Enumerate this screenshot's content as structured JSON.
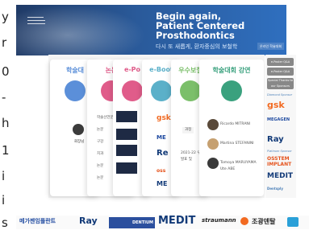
{
  "left_edge": [
    "y",
    "r",
    "0",
    "-",
    "h",
    "1",
    "i",
    "i",
    "s"
  ],
  "banner": {
    "title_line1": "Begin again,",
    "title_line2": "Patient Centered",
    "title_line3": "Prosthodontics",
    "subtitle": "다시 또 새롭게, 환자중심의 보철학",
    "corner": "온라인 학술대회"
  },
  "cards": [
    {
      "heading": "학술대",
      "color": "#5b8fd9"
    },
    {
      "heading": "논문",
      "color": "#e05c8a"
    },
    {
      "heading": "e-Po",
      "color": "#e05c8a"
    },
    {
      "heading": "e-Boot",
      "color": "#5bb0c9"
    },
    {
      "heading": "우수보철",
      "color": "#7bbf6a"
    },
    {
      "heading": "학술대회 강연",
      "color": "#3aa17e"
    }
  ],
  "card2_rows": [
    "학술선언문",
    "논문",
    "구강",
    "치과",
    "논문",
    "논문"
  ],
  "card4_brands": [
    "gsk",
    "ME",
    "Re",
    "oss",
    "ME"
  ],
  "speakers": [
    "Ricardo MITRANI",
    "Martina STEFANINI",
    "Tomoya MARUYAMA",
    "Ute ABE"
  ],
  "prize_text": [
    "2021-22 우수",
    "발표 및"
  ],
  "sidebar": {
    "buttons": [
      "e-Poster Q&A",
      "e-Poster Q&A",
      "Special Thanks to our Sponsors"
    ],
    "diamond_label": "Diamond Sponsor",
    "platinum_label": "Platinum Sponsor",
    "sponsors": [
      "gsk",
      "MEGAGEN",
      "Ray",
      "OSSTEM IMPLANT",
      "MEDIT",
      "Dentsply"
    ]
  },
  "bottom_logos": [
    "메가젠임플란트",
    "Ray",
    "DENTIUM",
    "MEDIT",
    "straumann",
    "조광덴탈"
  ]
}
